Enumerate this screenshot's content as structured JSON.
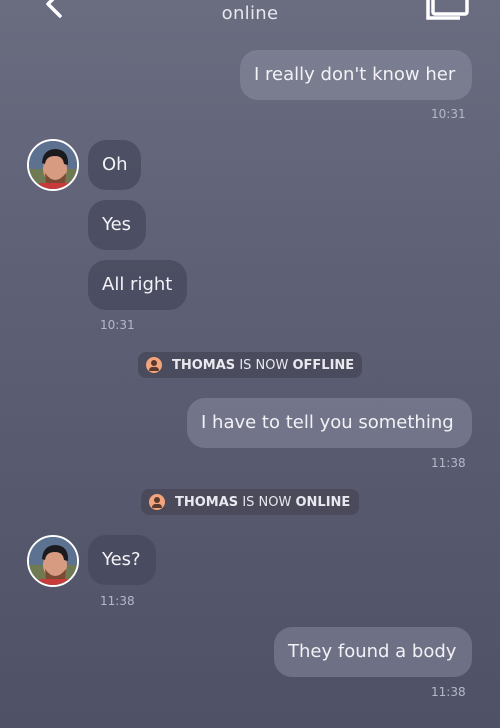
{
  "header": {
    "back_icon": "chevron-left-icon",
    "status": "online",
    "gallery_icon": "gallery-icon"
  },
  "messages": [
    {
      "direction": "out",
      "text": "I really don't know her",
      "time": "10:31"
    },
    {
      "direction": "in",
      "text": "Oh"
    },
    {
      "direction": "in",
      "text": "Yes"
    },
    {
      "direction": "in",
      "text": "All right",
      "time": "10:31"
    },
    {
      "direction": "out",
      "text": "I have to tell you something",
      "time": "11:38"
    },
    {
      "direction": "in",
      "text": "Yes?",
      "time": "11:38"
    },
    {
      "direction": "out",
      "text": "They found a body",
      "time": "11:38"
    }
  ],
  "system_notices": [
    {
      "name": "THOMAS",
      "middle": "IS NOW",
      "state": "OFFLINE",
      "icon": "user-icon",
      "color": "#f4a47c"
    },
    {
      "name": "THOMAS",
      "middle": "IS NOW",
      "state": "ONLINE",
      "icon": "user-icon",
      "color": "#f4a47c"
    }
  ],
  "colors": {
    "background_top": "#6a6c80",
    "background_bottom": "#4f5167",
    "outgoing_bubble": "#8f91a6",
    "incoming_bubble": "#46485c",
    "system_icon": "#f4a47c"
  }
}
